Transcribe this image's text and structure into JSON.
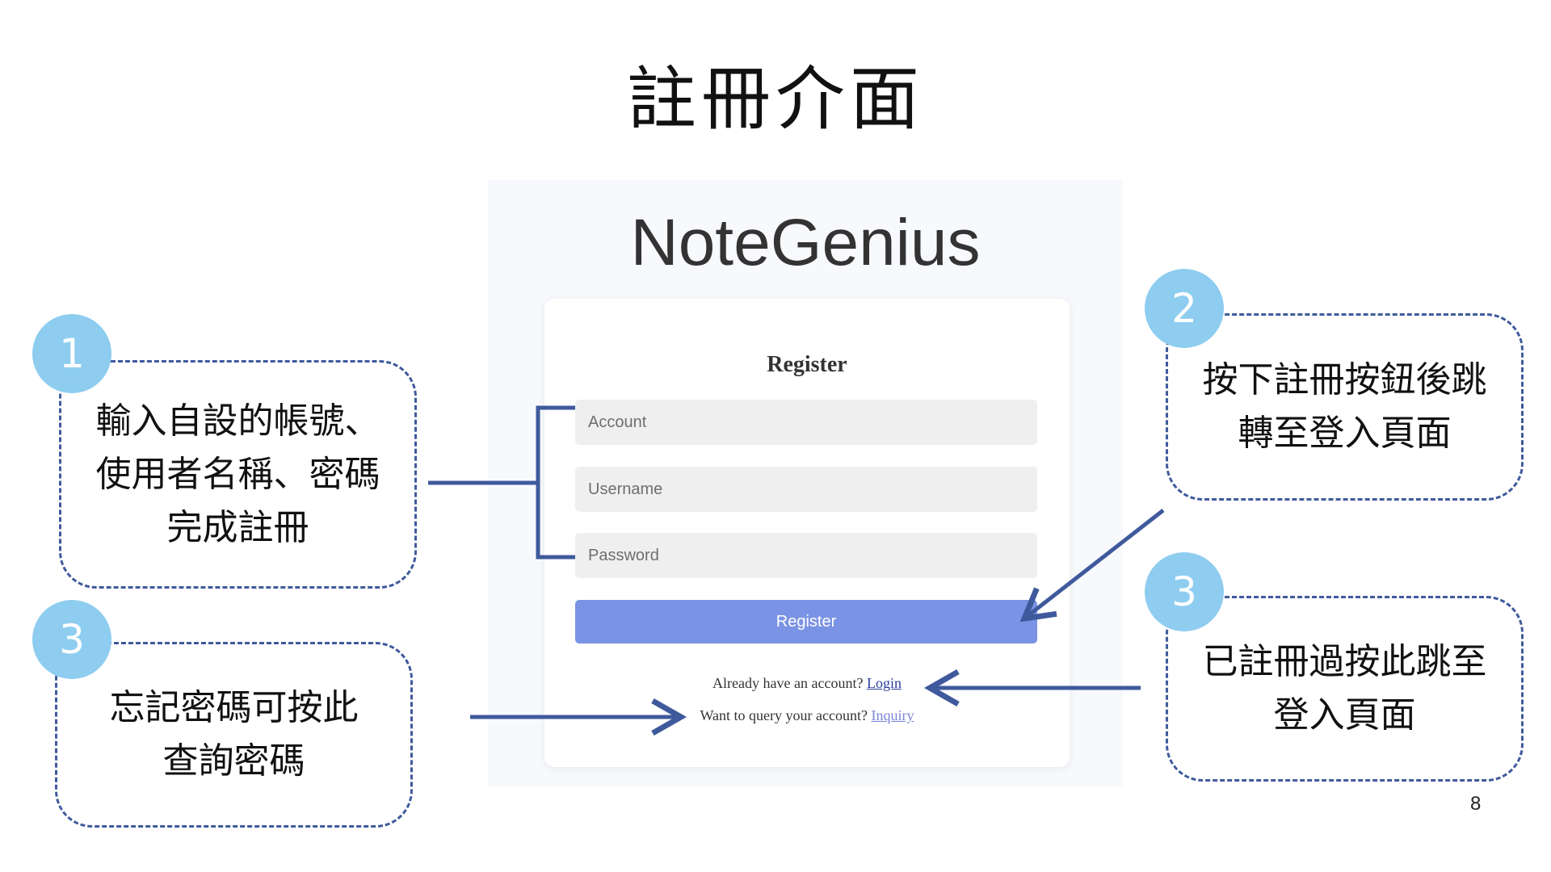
{
  "slide": {
    "title": "註冊介面",
    "page_number": "8"
  },
  "app": {
    "brand": "NoteGenius",
    "form_title": "Register",
    "fields": {
      "account_placeholder": "Account",
      "username_placeholder": "Username",
      "password_placeholder": "Password"
    },
    "register_button": "Register",
    "login_prompt": "Already have an account?",
    "login_link": "Login",
    "inquiry_prompt": "Want to query your account?",
    "inquiry_link": "Inquiry"
  },
  "callouts": [
    {
      "badge": "1",
      "lines": [
        "輸入自設的帳號、",
        "使用者名稱、密碼",
        "完成註冊"
      ]
    },
    {
      "badge": "2",
      "lines": [
        "按下註冊按鈕後跳",
        "轉至登入頁面"
      ]
    },
    {
      "badge": "3",
      "lines": [
        "已註冊過按此跳至",
        "登入頁面"
      ]
    },
    {
      "badge": "3",
      "lines": [
        "忘記密碼可按此",
        "查詢密碼"
      ]
    }
  ],
  "colors": {
    "accent_button": "#7b93e4",
    "callout_border": "#3f5a9c",
    "badge": "#8ecdf0",
    "login_link": "#2b3fa0",
    "inquiry_link": "#7a86d6"
  }
}
